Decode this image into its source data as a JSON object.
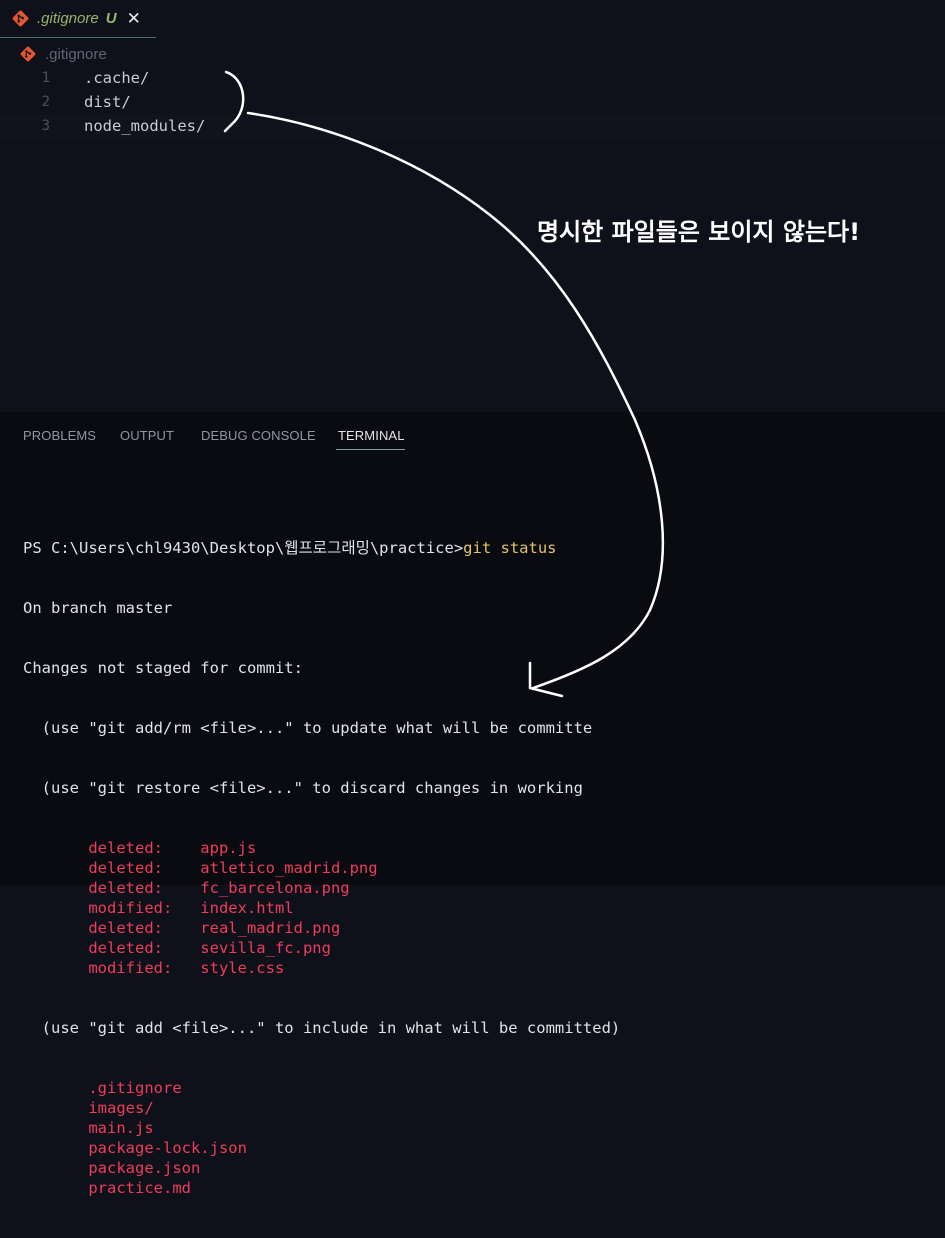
{
  "tab": {
    "file_name": ".gitignore",
    "status": "U"
  },
  "breadcrumb": {
    "label": ".gitignore"
  },
  "editor": {
    "lines": [
      {
        "number": "1",
        "text": ".cache/"
      },
      {
        "number": "2",
        "text": "dist/"
      },
      {
        "number": "3",
        "text": "node_modules/"
      }
    ]
  },
  "annotation": {
    "text": "명시한 파일들은 보이지 않는다!"
  },
  "panel": {
    "tabs": [
      "PROBLEMS",
      "OUTPUT",
      "DEBUG CONSOLE",
      "TERMINAL"
    ],
    "active_tab": "TERMINAL"
  },
  "terminal": {
    "prompt": "PS C:\\Users\\chl9430\\Desktop\\웹프로그래밍\\practice>",
    "command": "git status",
    "branch_line": "On branch master",
    "changes_header": "Changes not staged for commit:",
    "hint1": "  (use \"git add/rm <file>...\" to update what will be committe",
    "hint2": "  (use \"git restore <file>...\" to discard changes in working",
    "changes": [
      {
        "status": "deleted:",
        "file": "app.js"
      },
      {
        "status": "deleted:",
        "file": "atletico_madrid.png"
      },
      {
        "status": "deleted:",
        "file": "fc_barcelona.png"
      },
      {
        "status": "modified:",
        "file": "index.html"
      },
      {
        "status": "deleted:",
        "file": "real_madrid.png"
      },
      {
        "status": "deleted:",
        "file": "sevilla_fc.png"
      },
      {
        "status": "modified:",
        "file": "style.css"
      }
    ],
    "untracked_hint": "  (use \"git add <file>...\" to include in what will be committed)",
    "untracked": [
      ".gitignore",
      "images/",
      "main.js",
      "package-lock.json",
      "package.json",
      "practice.md"
    ]
  },
  "colors": {
    "git_icon": "#e4572e",
    "modified_tab": "#98b56e",
    "terminal_red": "#ee3c5c",
    "command_yellow": "#e5c26a"
  },
  "icons": [
    "git-file-icon",
    "close-icon"
  ]
}
